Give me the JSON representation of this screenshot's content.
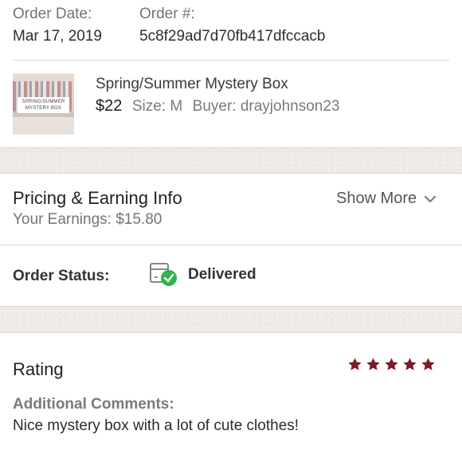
{
  "order": {
    "date_label": "Order Date:",
    "date_value": "Mar 17, 2019",
    "number_label": "Order #:",
    "number_value": "5c8f29ad7d70fb417dfccacb"
  },
  "product": {
    "thumbnail_text": "SPRING/SUMMER MYSTERY BOX",
    "title": "Spring/Summer Mystery Box",
    "price": "$22",
    "size": "Size: M",
    "buyer": "Buyer: drayjohnson23"
  },
  "pricing": {
    "title": "Pricing & Earning Info",
    "earnings": "Your Earnings: $15.80",
    "show_more": "Show More"
  },
  "status": {
    "label": "Order Status:",
    "value": "Delivered"
  },
  "rating": {
    "title": "Rating",
    "stars": 5,
    "comments_label": "Additional Comments:",
    "comments": "Nice mystery box with a lot of cute clothes!"
  },
  "colors": {
    "star": "#7b1a2c",
    "delivered_check": "#2fb34a",
    "band": "#efece8"
  },
  "icons": [
    "chevron-down-icon",
    "package-delivered-icon",
    "star-icon"
  ]
}
